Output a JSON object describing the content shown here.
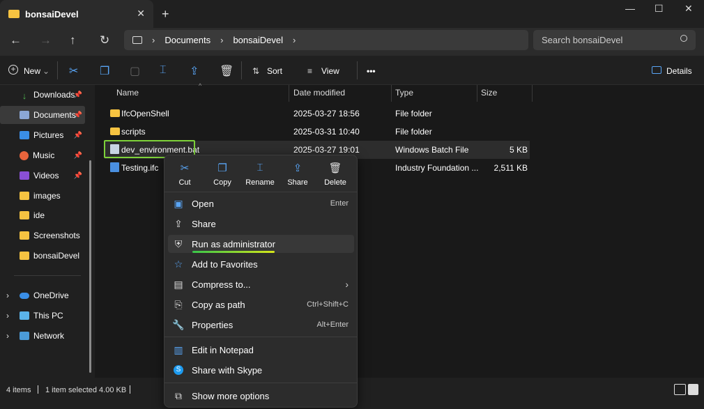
{
  "window": {
    "tab_title": "bonsaiDevel",
    "minimize": "—",
    "maximize": "☐",
    "close": "✕",
    "new_tab": "+"
  },
  "nav": {
    "back": "←",
    "forward": "→",
    "up": "↑",
    "refresh": "↻",
    "breadcrumb": [
      "Documents",
      "bonsaiDevel"
    ],
    "search_placeholder": "Search bonsaiDevel"
  },
  "toolbar": {
    "new_label": "New",
    "sort_label": "Sort",
    "view_label": "View",
    "more_label": "•••",
    "details_label": "Details"
  },
  "sidebar": {
    "items": [
      {
        "label": "Downloads",
        "icon": "download-icon",
        "pinned": true
      },
      {
        "label": "Documents",
        "icon": "documents-icon",
        "pinned": true,
        "selected": true
      },
      {
        "label": "Pictures",
        "icon": "pictures-icon",
        "pinned": true
      },
      {
        "label": "Music",
        "icon": "music-icon",
        "pinned": true
      },
      {
        "label": "Videos",
        "icon": "videos-icon",
        "pinned": true
      },
      {
        "label": "images",
        "icon": "folder-icon"
      },
      {
        "label": "ide",
        "icon": "folder-icon"
      },
      {
        "label": "Screenshots",
        "icon": "folder-icon"
      },
      {
        "label": "bonsaiDevel",
        "icon": "folder-icon"
      }
    ],
    "roots": [
      {
        "label": "OneDrive",
        "icon": "onedrive-icon"
      },
      {
        "label": "This PC",
        "icon": "pc-icon"
      },
      {
        "label": "Network",
        "icon": "network-icon"
      }
    ]
  },
  "columns": {
    "name": "Name",
    "date": "Date modified",
    "type": "Type",
    "size": "Size"
  },
  "files": [
    {
      "name": "IfcOpenShell",
      "date": "2025-03-27 18:56",
      "type": "File folder",
      "size": ""
    },
    {
      "name": "scripts",
      "date": "2025-03-31 10:40",
      "type": "File folder",
      "size": ""
    },
    {
      "name": "dev_environment.bat",
      "date": "2025-03-27 19:01",
      "type": "Windows Batch File",
      "size": "5 KB"
    },
    {
      "name": "Testing.ifc",
      "date": "",
      "type": "Industry Foundation ...",
      "size": "2,511 KB"
    }
  ],
  "status": {
    "count": "4 items",
    "selected": "1 item selected  4.00 KB"
  },
  "context_menu": {
    "quick_actions": [
      "Cut",
      "Copy",
      "Rename",
      "Share",
      "Delete"
    ],
    "items": [
      {
        "label": "Open",
        "shortcut": "Enter"
      },
      {
        "label": "Share",
        "shortcut": ""
      },
      {
        "label": "Run as administrator",
        "shortcut": ""
      },
      {
        "label": "Add to Favorites",
        "shortcut": ""
      },
      {
        "label": "Compress to...",
        "shortcut": "›"
      },
      {
        "label": "Copy as path",
        "shortcut": "Ctrl+Shift+C"
      },
      {
        "label": "Properties",
        "shortcut": "Alt+Enter"
      },
      {
        "label": "Edit in Notepad",
        "shortcut": ""
      },
      {
        "label": "Share with Skype",
        "shortcut": ""
      },
      {
        "label": "Show more options",
        "shortcut": ""
      }
    ]
  }
}
